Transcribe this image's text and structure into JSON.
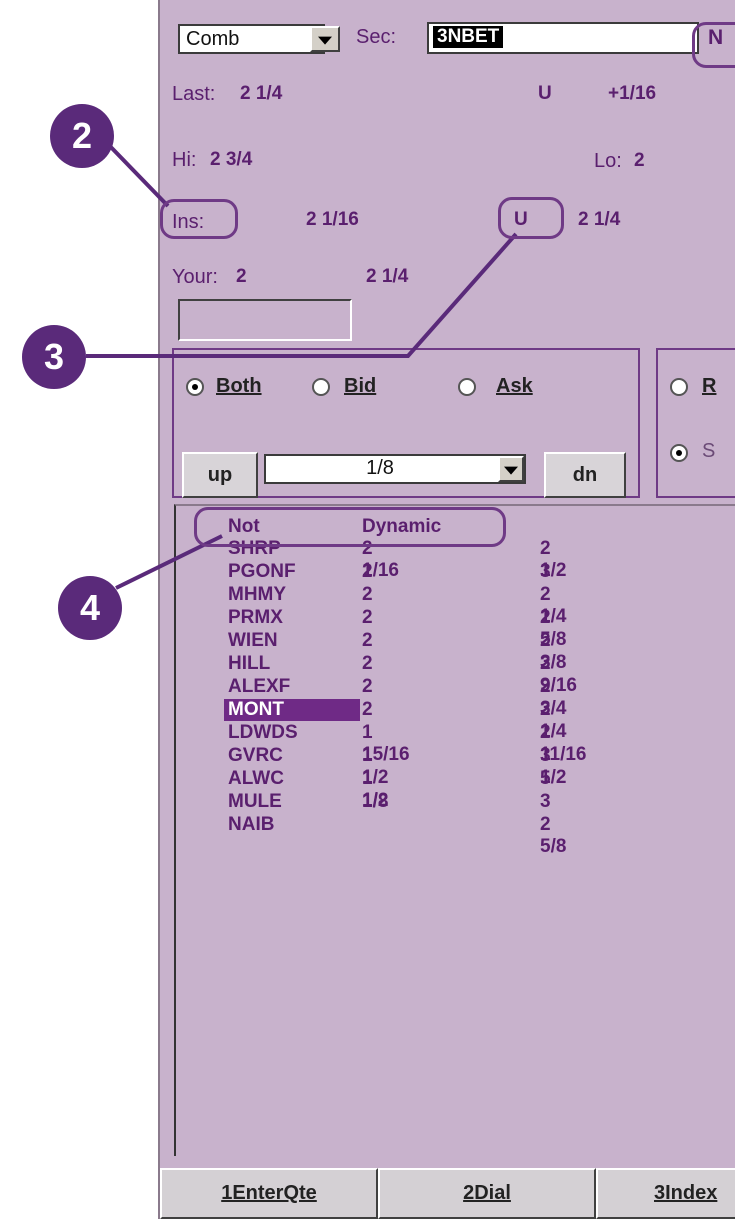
{
  "header": {
    "combo_value": "Comb",
    "sec_label": "Sec:",
    "sec_value": "3NBET",
    "corner_label": "N"
  },
  "quotes": {
    "last_label": "Last:",
    "last_value": "2 1/4",
    "tick": "U",
    "change": "+1/16",
    "hi_label": "Hi:",
    "hi_value": "2 3/4",
    "lo_label": "Lo:",
    "lo_value": "2",
    "ins_label": "Ins:",
    "ins_bid": "2 1/16",
    "ins_tick": "U",
    "ins_ask": "2 1/4",
    "your_label": "Your:",
    "your_bid": "2",
    "your_ask": "2 1/4"
  },
  "side_group": {
    "both": "Both",
    "bid": "Bid",
    "ask": "Ask",
    "selected": "Both",
    "up_label": "up",
    "dn_label": "dn",
    "step_value": "1/8"
  },
  "right_group": {
    "r_label": "R",
    "s_label": "S"
  },
  "mm_list": {
    "header_col1": "Not",
    "header_col2": "Dynamic",
    "rows": [
      {
        "mm": "SHRP",
        "bid": "2 1/16",
        "ask": "2 1/2"
      },
      {
        "mm": "PGONF",
        "bid": "2",
        "ask": "3"
      },
      {
        "mm": "MHMY",
        "bid": "2",
        "ask": "2 1/4"
      },
      {
        "mm": "PRMX",
        "bid": "2",
        "ask": "2 5/8"
      },
      {
        "mm": "WIEN",
        "bid": "2",
        "ask": "2 3/8"
      },
      {
        "mm": "HILL",
        "bid": "2",
        "ask": "2 9/16"
      },
      {
        "mm": "ALEXF",
        "bid": "2",
        "ask": "2 3/4"
      },
      {
        "mm": "MONT",
        "bid": "2",
        "ask": "2 1/4",
        "selected": true
      },
      {
        "mm": "LDWDS",
        "bid": "1 15/16",
        "ask": "2 11/16"
      },
      {
        "mm": "GVRC",
        "bid": "1 1/2",
        "ask": "3 1/2"
      },
      {
        "mm": "ALWC",
        "bid": "1 1/2",
        "ask": "5"
      },
      {
        "mm": "MULE",
        "bid": "1/8",
        "ask": "3"
      },
      {
        "mm": "NAIB",
        "bid": "",
        "ask": "2 5/8"
      }
    ]
  },
  "footer": {
    "btn1": "1EnterQte",
    "btn2": "2Dial",
    "btn3": "3Index"
  },
  "callouts": [
    "2",
    "3",
    "4"
  ]
}
